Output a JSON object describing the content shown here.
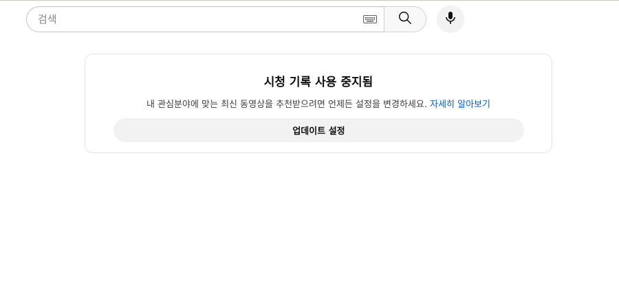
{
  "search": {
    "placeholder": "검색",
    "value": ""
  },
  "icons": {
    "keyboard": "keyboard-icon",
    "search": "search-icon",
    "mic": "mic-icon"
  },
  "history_notice": {
    "title": "시청 기록 사용 중지됨",
    "description": "내 관심분야에 맞는 최신 동영상을 추천받으려면 언제든 설정을 변경하세요.",
    "learn_more_label": "자세히 알아보기",
    "update_button_label": "업데이트 설정"
  },
  "colors": {
    "link": "#065fd4",
    "button_bg": "#f2f2f2",
    "text_primary": "#0f0f0f"
  }
}
